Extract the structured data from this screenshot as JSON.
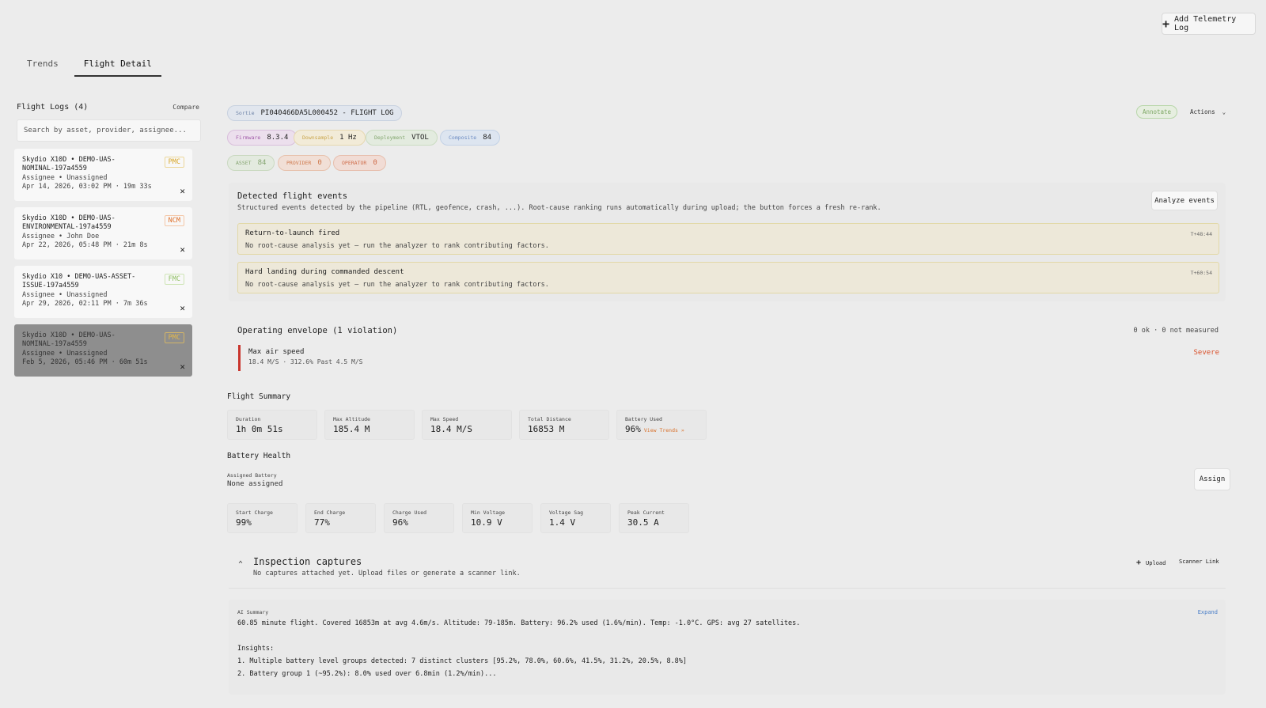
{
  "header": {
    "add_button": "Add Telemetry Log"
  },
  "tabs": [
    {
      "label": "Trends"
    },
    {
      "label": "Flight Detail"
    }
  ],
  "sidebar": {
    "title": "Flight Logs (4)",
    "compare": "Compare",
    "search_placeholder": "Search by asset, provider, assignee...",
    "cards": [
      {
        "title": "Skydio X10D • DEMO-UAS-NOMINAL-197a4559",
        "assignee": "Assignee • Unassigned",
        "date": "Apr 14, 2026, 03:02 PM · 19m 33s",
        "status": "PMC"
      },
      {
        "title": "Skydio X10D • DEMO-UAS-ENVIRONMENTAL-197a4559",
        "assignee": "Assignee • John Doe",
        "date": "Apr 22, 2026, 05:48 PM · 21m 8s",
        "status": "NCM"
      },
      {
        "title": "Skydio X10 • DEMO-UAS-ASSET-ISSUE-197a4559",
        "assignee": "Assignee • Unassigned",
        "date": "Apr 29, 2026, 02:11 PM · 7m 36s",
        "status": "FMC"
      },
      {
        "title": "Skydio X10D • DEMO-UAS-NOMINAL-197a4559",
        "assignee": "Assignee • Unassigned",
        "date": "Feb 5, 2026, 05:46 PM · 60m 51s",
        "status": "PMC"
      }
    ]
  },
  "flight": {
    "sortie_label": "Sortie",
    "sortie_value": "PI040466DA5L000452 - FLIGHT LOG",
    "chips": {
      "firmware": {
        "label": "Firmware",
        "value": "8.3.4"
      },
      "downsample": {
        "label": "Downsample",
        "value": "1 Hz"
      },
      "deployment": {
        "label": "Deployment",
        "value": "VTOL"
      },
      "composite": {
        "label": "Composite",
        "value": "84"
      },
      "asset": {
        "label": "ASSET",
        "value": "84"
      },
      "provider": {
        "label": "PROVIDER",
        "value": "0"
      },
      "operator": {
        "label": "OPERATOR",
        "value": "0"
      }
    },
    "annotate": "Annotate",
    "actions": "Actions"
  },
  "events": {
    "title": "Detected flight events",
    "description": "Structured events detected by the pipeline (RTL, geofence, crash, ...). Root-cause ranking runs automatically during upload; the button forces a fresh re-rank.",
    "analyze_button": "Analyze events",
    "items": [
      {
        "name": "Return-to-launch fired",
        "detail": "No root-cause analysis yet — run the analyzer to rank contributing factors.",
        "time": "T+48:44"
      },
      {
        "name": "Hard landing during commanded descent",
        "detail": "No root-cause analysis yet — run the analyzer to rank contributing factors.",
        "time": "T+60:54"
      }
    ]
  },
  "envelope": {
    "title": "Operating envelope (1 violation)",
    "stats": "0 ok · 0 not measured",
    "violation": {
      "name": "Max air speed",
      "detail": "18.4 M/S · 312.6% Past 4.5 M/S",
      "severity": "Severe"
    }
  },
  "summary": {
    "title": "Flight Summary",
    "metrics": [
      {
        "label": "Duration",
        "value": "1h 0m 51s"
      },
      {
        "label": "Max Altitude",
        "value": "185.4 M"
      },
      {
        "label": "Max Speed",
        "value": "18.4 M/S"
      },
      {
        "label": "Total Distance",
        "value": "16853 M"
      },
      {
        "label": "Battery Used",
        "value": "96%"
      }
    ],
    "view_trends": "View Trends »"
  },
  "battery": {
    "title": "Battery Health",
    "assigned_label": "Assigned Battery",
    "assigned_value": "None assigned",
    "assign_button": "Assign",
    "metrics": [
      {
        "label": "Start Charge",
        "value": "99%"
      },
      {
        "label": "End Charge",
        "value": "77%"
      },
      {
        "label": "Charge Used",
        "value": "96%"
      },
      {
        "label": "Min Voltage",
        "value": "10.9 V"
      },
      {
        "label": "Voltage Sag",
        "value": "1.4 V"
      },
      {
        "label": "Peak Current",
        "value": "30.5 A"
      }
    ]
  },
  "inspection": {
    "title": "Inspection captures",
    "description": "No captures attached yet. Upload files or generate a scanner link.",
    "upload": "Upload",
    "scanner": "Scanner Link"
  },
  "ai": {
    "label": "AI Summary",
    "expand": "Expand",
    "text": "60.85 minute flight. Covered 16853m at avg 4.6m/s. Altitude: 79-185m. Battery: 96.2% used (1.6%/min). Temp: -1.0°C. GPS: avg 27 satellites.",
    "insights_title": "Insights:",
    "insights": [
      "1. Multiple battery level groups detected: 7 distinct clusters [95.2%, 78.0%, 60.6%, 41.5%, 31.2%, 20.5%, 8.8%]",
      "2. Battery group 1 (~95.2%): 8.0% used over 6.8min (1.2%/min)..."
    ]
  }
}
